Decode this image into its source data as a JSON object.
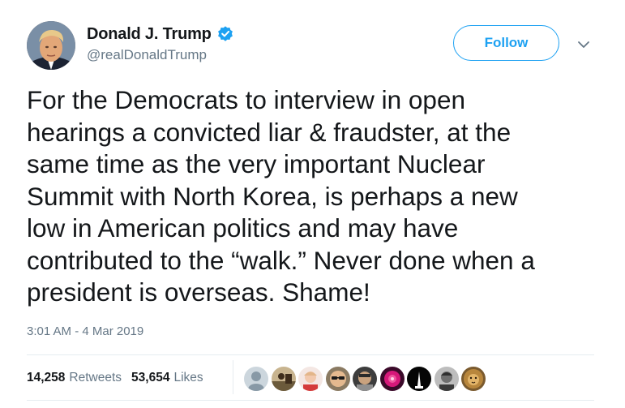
{
  "author": {
    "display_name": "Donald J. Trump",
    "handle": "@realDonaldTrump",
    "verified": true
  },
  "actions": {
    "follow_label": "Follow"
  },
  "tweet": {
    "text": "For the Democrats to interview in open\nhearings a convicted liar & fraudster, at the\nsame time as the very important Nuclear\nSummit with North Korea, is perhaps a new\nlow in American politics and may have\ncontributed to the “walk.” Never done when a\npresident is overseas. Shame!",
    "timestamp": "3:01 AM - 4 Mar 2019"
  },
  "stats": {
    "retweets_count": "14,258",
    "retweets_label": "Retweets",
    "likes_count": "53,654",
    "likes_label": "Likes"
  },
  "colors": {
    "brand_blue": "#1da1f2",
    "secondary_text": "#657786",
    "primary_text": "#14171a",
    "divider": "#e6ecf0"
  }
}
